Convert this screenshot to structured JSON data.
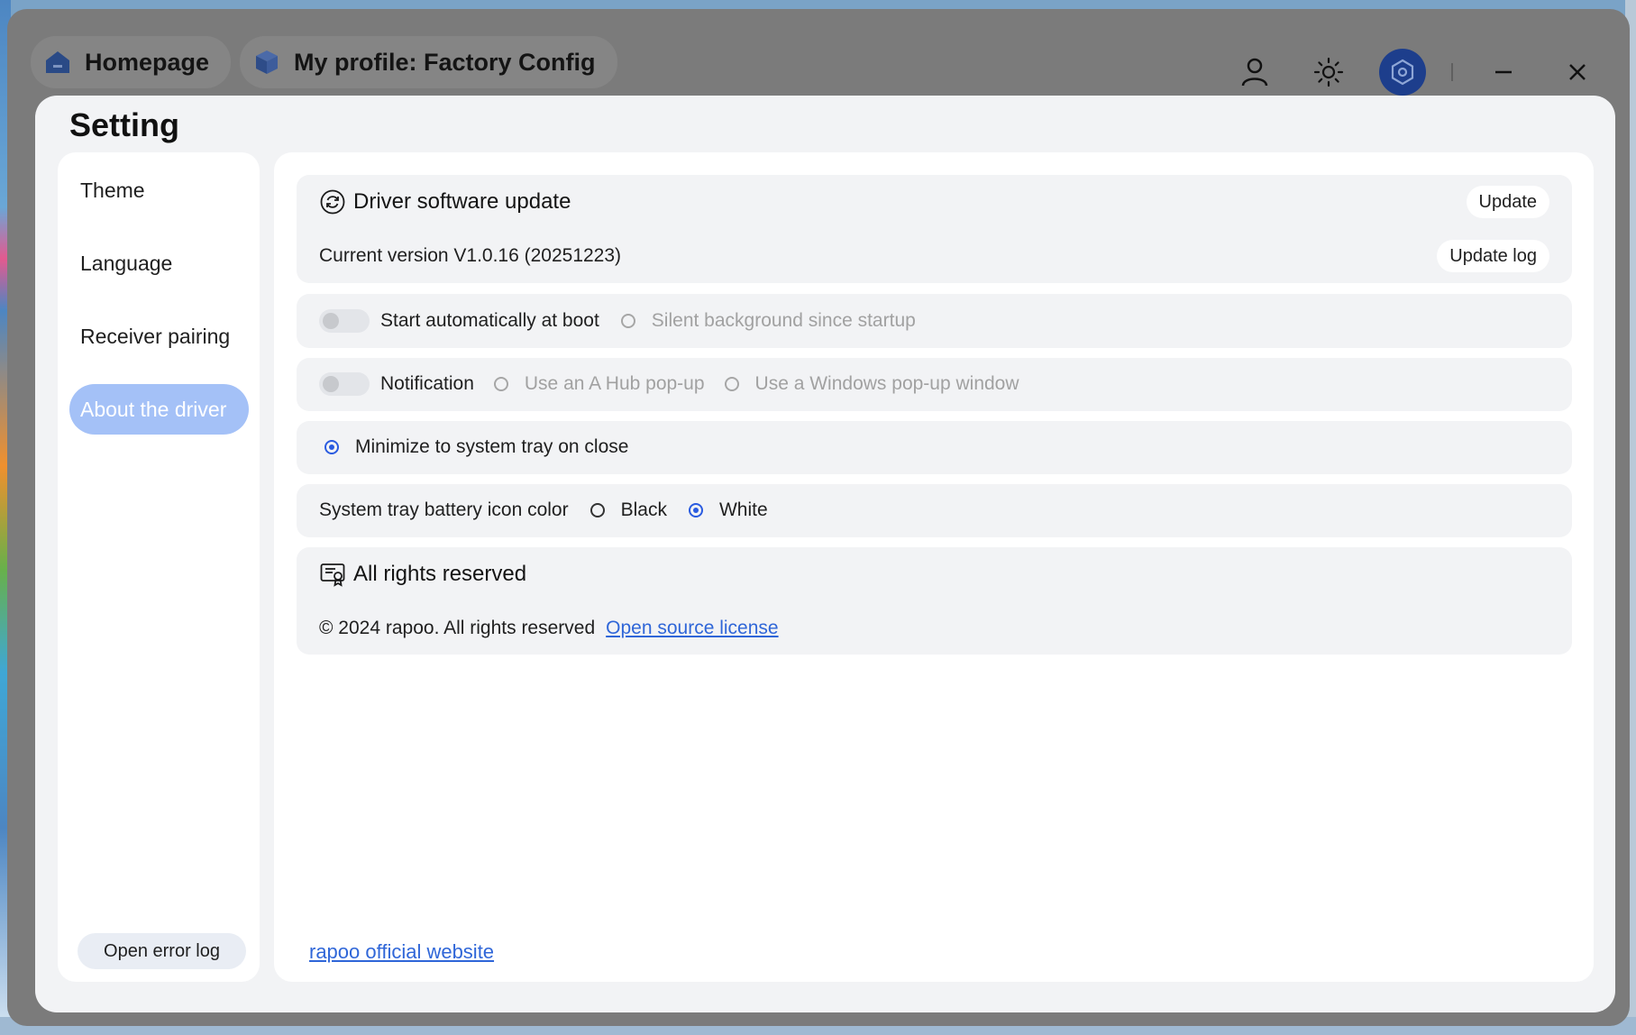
{
  "titlebar": {
    "tabs": [
      {
        "label": "Homepage"
      },
      {
        "label": "My profile: Factory Config"
      }
    ]
  },
  "dialog": {
    "title": "Setting"
  },
  "sidebar": {
    "items": [
      {
        "label": "Theme"
      },
      {
        "label": "Language"
      },
      {
        "label": "Receiver pairing"
      },
      {
        "label": "About the driver",
        "active": true
      }
    ],
    "error_log_label": "Open error log"
  },
  "update_card": {
    "title": "Driver software update",
    "update_button": "Update",
    "version_text": "Current version V1.0.16 (20251223)",
    "log_button": "Update log"
  },
  "boot_row": {
    "label": "Start automatically at boot",
    "enabled": false,
    "option": "Silent background since startup"
  },
  "notification_row": {
    "label": "Notification",
    "enabled": false,
    "options": [
      "Use an A Hub pop-up",
      "Use a Windows pop-up window"
    ]
  },
  "tray_row": {
    "label": "Minimize to system tray on close",
    "checked": true
  },
  "battery_row": {
    "label": "System tray battery icon color",
    "options": [
      "Black",
      "White"
    ],
    "selected": "White"
  },
  "rights_card": {
    "title": "All rights reserved",
    "copyright": "© 2024 rapoo. All rights reserved",
    "license_link": "Open source license"
  },
  "footer": {
    "website_link": "rapoo official website"
  },
  "colors": {
    "accent": "#2a5be0",
    "active_nav": "#a4c1f7",
    "link": "#2f66d8",
    "overlay": "#7b7b7b"
  }
}
